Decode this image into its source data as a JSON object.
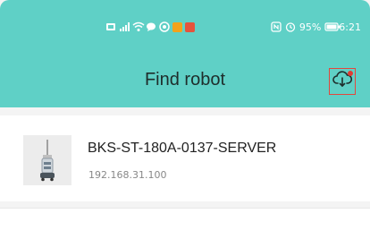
{
  "status_bar": {
    "battery": "95%",
    "time": "6:21",
    "icons": [
      "sim-icon",
      "signal-icon",
      "wifi-icon",
      "message-icon",
      "location-icon",
      "app-orange-icon",
      "app-red-icon",
      "nfc-icon",
      "alarm-icon",
      "battery-icon"
    ]
  },
  "header": {
    "title": "Find robot",
    "action_icon": "cloud-download-icon",
    "notification_color": "#e23b32"
  },
  "robots": [
    {
      "name": "BKS-ST-180A-0137-SERVER",
      "ip": "192.168.31.100"
    }
  ],
  "colors": {
    "accent": "#5fd0c6",
    "highlight_border": "#e2473d"
  }
}
